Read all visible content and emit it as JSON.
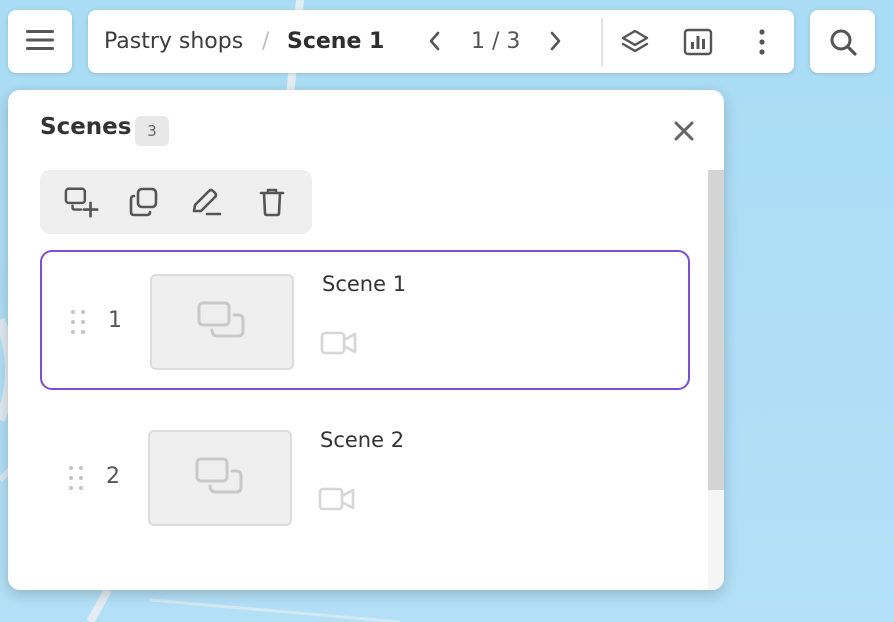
{
  "breadcrumb": {
    "root": "Pastry shops",
    "separator": "/",
    "current": "Scene 1"
  },
  "pager": {
    "text": "1 / 3"
  },
  "scenes_panel": {
    "title": "Scenes",
    "count": "3"
  },
  "scenes": [
    {
      "number": "1",
      "name": "Scene 1",
      "selected": true
    },
    {
      "number": "2",
      "name": "Scene 2",
      "selected": false
    }
  ],
  "icons": {
    "menu": "hamburger-icon",
    "search": "search-icon",
    "prev": "chevron-left-icon",
    "next": "chevron-right-icon",
    "layers": "layers-icon",
    "chart": "bar-chart-icon",
    "more": "more-vertical-icon",
    "close": "close-icon",
    "add_scene": "add-scene-icon",
    "duplicate": "duplicate-icon",
    "edit": "pencil-icon",
    "delete": "trash-icon",
    "drag": "drag-handle-icon",
    "thumbnail": "scene-placeholder-icon",
    "camera": "camera-icon"
  },
  "colors": {
    "accent": "#7c4ed8",
    "map_water": "#aadcf5",
    "icon": "#555555",
    "muted_icon": "#d0d0d0"
  }
}
